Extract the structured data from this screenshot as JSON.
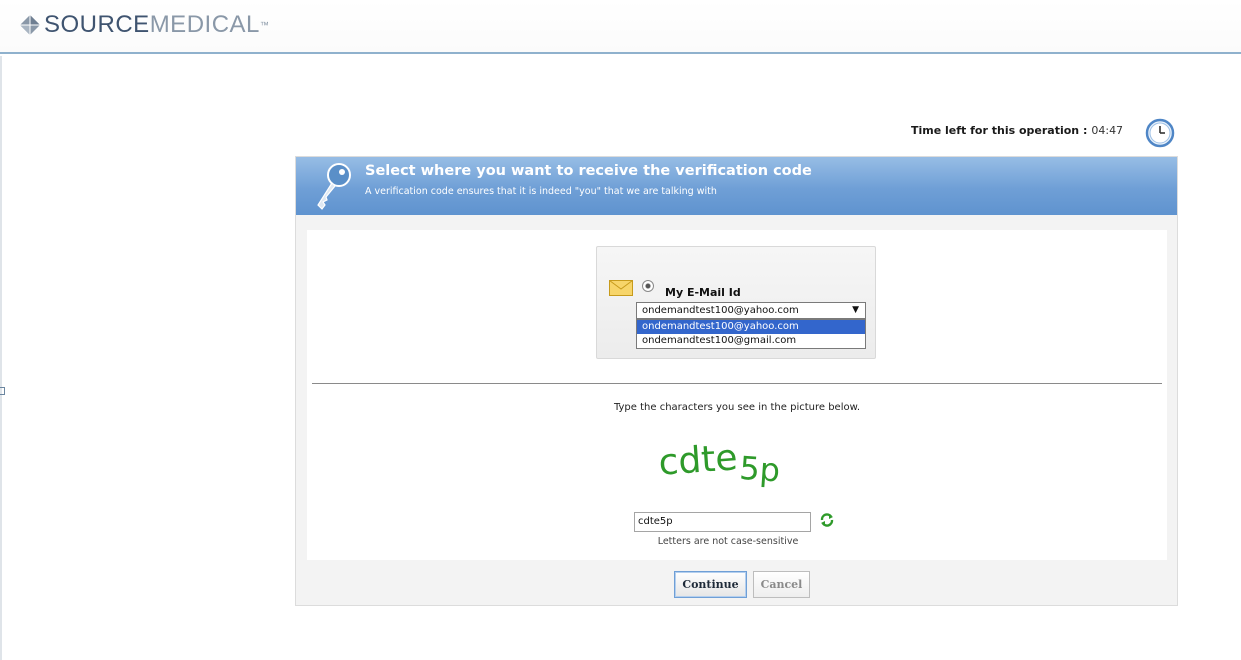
{
  "header": {
    "logo_bold": "SOURCE",
    "logo_light": "MEDICAL",
    "logo_tm": "™"
  },
  "timer": {
    "label": "Time left for this operation :",
    "value": "04:47"
  },
  "banner": {
    "title": "Select where you want to receive the verification code",
    "subtitle": "A verification code ensures that it is indeed \"you\" that we are talking with"
  },
  "email": {
    "label": "My E-Mail Id",
    "selected_value": "ondemandtest100@yahoo.com",
    "options": [
      "ondemandtest100@yahoo.com",
      "ondemandtest100@gmail.com"
    ]
  },
  "captcha": {
    "instruction": "Type the characters you see in the picture below.",
    "image_text": "cdte5p",
    "input_value": "cdte5p",
    "hint": "Letters are not case-sensitive"
  },
  "buttons": {
    "continue_label": "Continue",
    "cancel_label": "Cancel"
  },
  "colors": {
    "banner": "#6f9fd6",
    "header_rule": "#8fb1cd",
    "selected_option": "#3366cc",
    "captcha_green": "#2e9a2a"
  }
}
